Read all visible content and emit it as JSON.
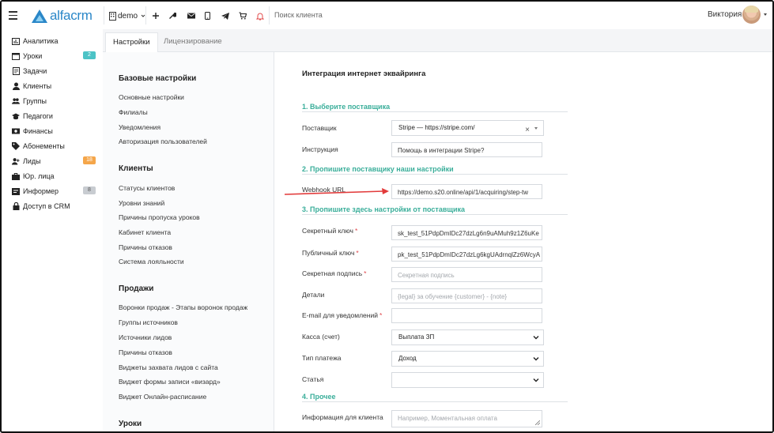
{
  "app": {
    "logo_text": "alfacrm",
    "workspace": "demo",
    "search_placeholder": "Поиск клиента",
    "user_name": "Виктория"
  },
  "sidebar": {
    "items": [
      {
        "label": "Аналитика",
        "icon": "analytics-icon"
      },
      {
        "label": "Уроки",
        "icon": "calendar-icon",
        "badge": "2"
      },
      {
        "label": "Задачи",
        "icon": "tasks-icon"
      },
      {
        "label": "Клиенты",
        "icon": "user-icon"
      },
      {
        "label": "Группы",
        "icon": "users-icon"
      },
      {
        "label": "Педагоги",
        "icon": "teacher-icon"
      },
      {
        "label": "Финансы",
        "icon": "money-icon"
      },
      {
        "label": "Абонементы",
        "icon": "tag-icon"
      },
      {
        "label": "Лиды",
        "icon": "user-plus-icon",
        "badge": "18"
      },
      {
        "label": "Юр. лица",
        "icon": "briefcase-icon"
      },
      {
        "label": "Информер",
        "icon": "informer-icon",
        "badge": "8"
      },
      {
        "label": "Доступ в CRM",
        "icon": "lock-icon"
      }
    ]
  },
  "tabs": {
    "settings": "Настройки",
    "licensing": "Лицензирование"
  },
  "settings_nav": {
    "sections": [
      {
        "title": "Базовые настройки",
        "links": [
          "Основные настройки",
          "Филиалы",
          "Уведомления",
          "Авторизация пользователей"
        ]
      },
      {
        "title": "Клиенты",
        "links": [
          "Статусы клиентов",
          "Уровни знаний",
          "Причины пропуска уроков",
          "Кабинет клиента",
          "Причины отказов",
          "Система лояльности"
        ]
      },
      {
        "title": "Продажи",
        "links": [
          "Воронки продаж - Этапы воронок продаж",
          "Группы источников",
          "Источники лидов",
          "Причины отказов",
          "Виджеты захвата лидов с сайта",
          "Виджет формы записи «визард»",
          "Виджет Онлайн-расписание"
        ]
      },
      {
        "title": "Уроки",
        "links": []
      }
    ]
  },
  "form": {
    "title": "Интеграция интернет эквайринга",
    "section1": "1. Выберите поставщика",
    "provider_label": "Поставщик",
    "provider_value": "Stripe — https://stripe.com/",
    "instruction_label": "Инструкция",
    "instruction_value": "Помощь в интеграции Stripe?",
    "section2": "2. Пропишите поставщику наши настройки",
    "webhook_label": "Webhook URL",
    "webhook_value": "https://demo.s20.online/api/1/acquiring/step-tw",
    "section3": "3. Пропишите здесь настройки от поставщика",
    "secret_key_label": "Секретный ключ",
    "secret_key_value": "sk_test_51PdpDmIDc27dzLg6n9uAMuh9z1Z6uKe",
    "public_key_label": "Публичный ключ",
    "public_key_value": "pk_test_51PdpDmIDc27dzLg6kgUAdrnqlZz6WcyA",
    "signature_label": "Секретная подпись",
    "signature_placeholder": "Секретная подпись",
    "details_label": "Детали",
    "details_placeholder": "{legal} за обучение {customer} - {note}",
    "email_label": "E-mail для уведомлений",
    "email_value": "",
    "cashbox_label": "Касса (счет)",
    "cashbox_value": "Выплата ЗП",
    "payment_type_label": "Тип платежа",
    "payment_type_value": "Доход",
    "article_label": "Статья",
    "article_value": "",
    "section4": "4. Прочее",
    "client_info_label": "Информация для клиента",
    "client_info_placeholder": "Например, Моментальная оплата"
  },
  "colors": {
    "brand": "#2a87c8",
    "section_heading": "#3aae9a",
    "required": "#e0474c",
    "annotation_arrow": "#e23b3b"
  }
}
